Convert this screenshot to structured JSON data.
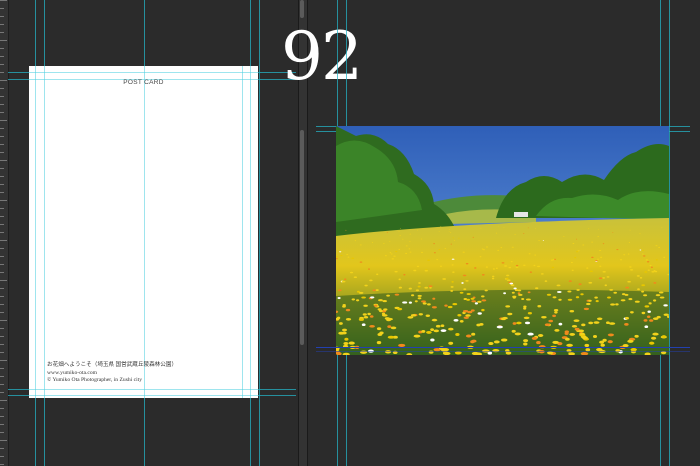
{
  "canvas": {
    "background": "#2b2b2b",
    "guide_color": "#25b3c6"
  },
  "left_document": {
    "postcard": {
      "title": "POST CARD",
      "caption_lines": [
        "お花畑へようこそ（埼玉県 国営武蔵丘陵森林公園）",
        "www.yumiko-ota.com",
        "© Yumiko Ota Photographer, in Zushi city"
      ]
    }
  },
  "page_number": "92",
  "right_document": {
    "photo": {
      "subject": "flower-field-photo",
      "sky_color": "#3d6fc4",
      "flower_colors": [
        "#f2d21b",
        "#f08a1c",
        "#ffffff",
        "#e8c700"
      ]
    }
  }
}
